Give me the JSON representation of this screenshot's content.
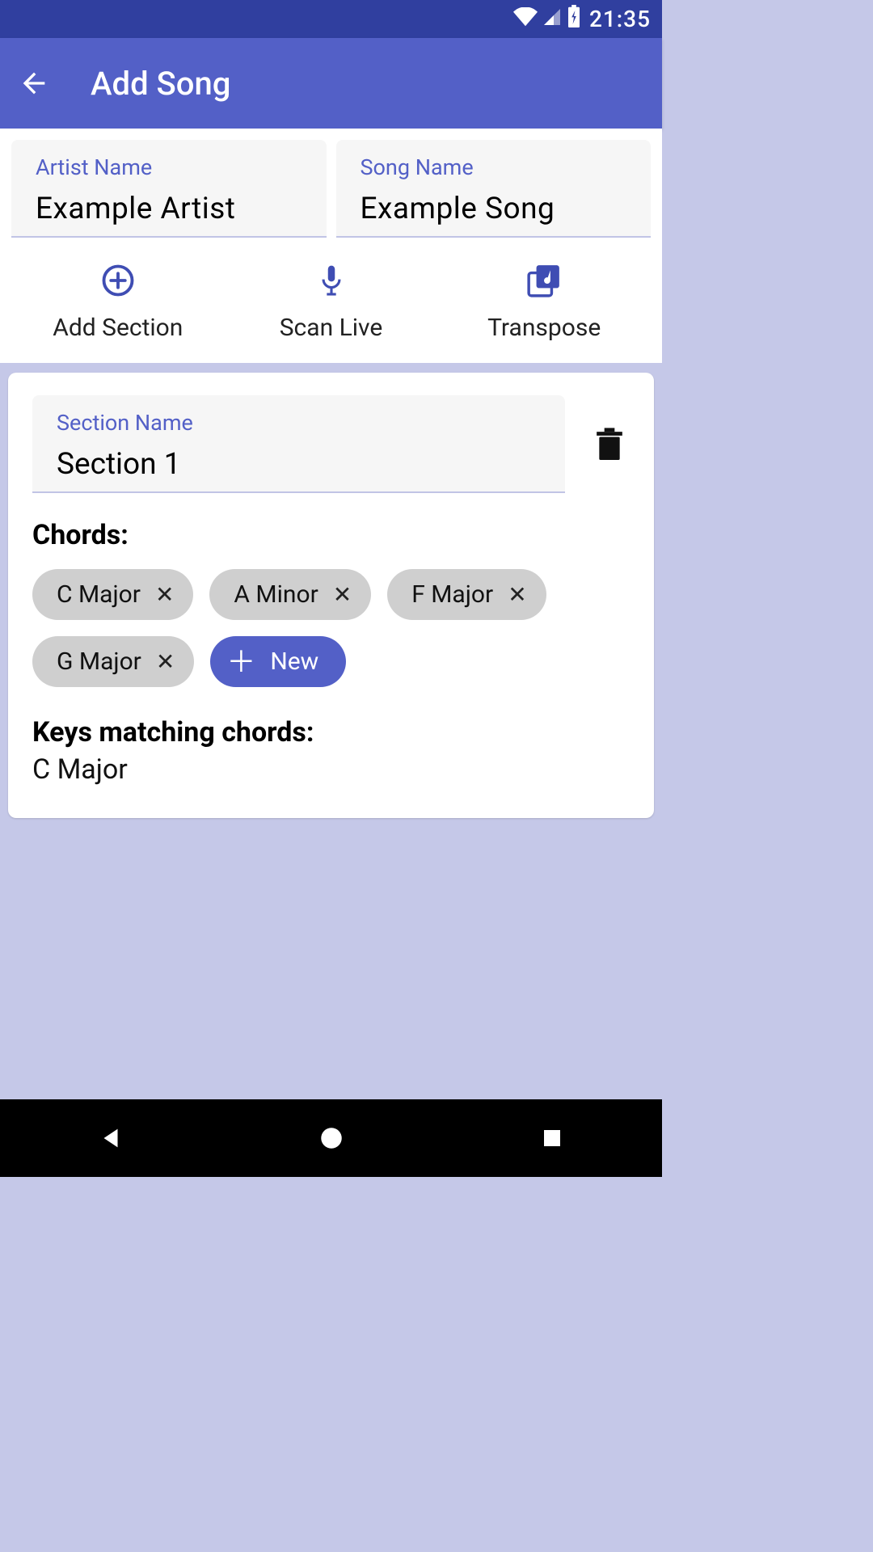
{
  "status": {
    "time": "21:35"
  },
  "appbar": {
    "title": "Add Song"
  },
  "fields": {
    "artist": {
      "label": "Artist Name",
      "value": "Example Artist"
    },
    "song": {
      "label": "Song Name",
      "value": "Example Song"
    }
  },
  "actions": {
    "add_section": "Add Section",
    "scan_live": "Scan Live",
    "transpose": "Transpose"
  },
  "section": {
    "name_label": "Section Name",
    "name_value": "Section 1",
    "chords_label": "Chords:",
    "chords": [
      "C Major",
      "A Minor",
      "F Major",
      "G Major"
    ],
    "new_chip": "New",
    "keys_label": "Keys matching chords:",
    "keys_value": "C Major"
  }
}
